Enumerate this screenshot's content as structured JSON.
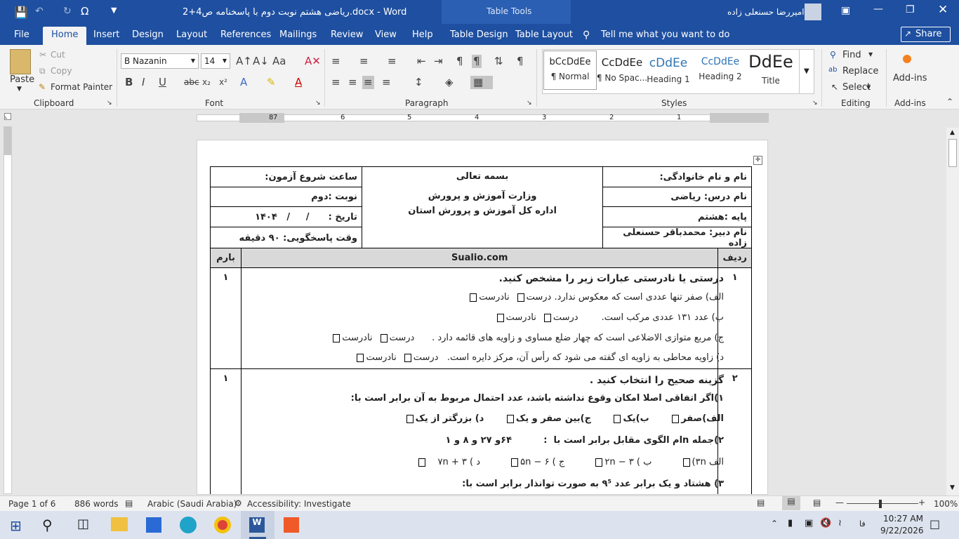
{
  "titlebar": {
    "doc_title": "ریاضی هشتم نوبت دوم با پاسخنامه ص4+2.docx - Word",
    "table_tools": "Table Tools",
    "user": "امیررضا حسنعلی زاده"
  },
  "tabs": [
    "File",
    "Home",
    "Insert",
    "Design",
    "Layout",
    "References",
    "Mailings",
    "Review",
    "View",
    "Help",
    "Table Design",
    "Table Layout"
  ],
  "tell_me": "Tell me what you want to do",
  "share": "Share",
  "clipboard": {
    "paste": "Paste",
    "cut": "Cut",
    "copy": "Copy",
    "format_painter": "Format Painter",
    "label": "Clipboard"
  },
  "font": {
    "name": "B Nazanin",
    "size": "14",
    "label": "Font"
  },
  "paragraph": {
    "label": "Paragraph"
  },
  "styles": {
    "label": "Styles",
    "items": [
      {
        "sample": "bCcDdEe",
        "name": "¶ Normal"
      },
      {
        "sample": "CcDdEe",
        "name": "¶ No Spac..."
      },
      {
        "sample": "cDdEe",
        "name": "Heading 1"
      },
      {
        "sample": "CcDdEe",
        "name": "Heading 2"
      },
      {
        "sample": "DdEe",
        "name": "Title"
      }
    ]
  },
  "editing": {
    "find": "Find",
    "replace": "Replace",
    "select": "Select",
    "label": "Editing"
  },
  "addins": {
    "button": "Add-ins",
    "label": "Add-ins"
  },
  "ruler_digits": [
    "8",
    "7",
    "6",
    "5",
    "4",
    "3",
    "2",
    "1"
  ],
  "exam": {
    "header": {
      "r1": {
        "right": "نام و نام خانوادگی:",
        "center": "بسمه تعالی",
        "left": "ساعت شروع آزمون:"
      },
      "r2": {
        "right": "نام درس: ریاضی",
        "center": "وزارت آموزش و پرورش",
        "left": "نوبت :دوم"
      },
      "r3": {
        "right": "پایه :هشتم",
        "center": "اداره کل آموزش و پرورش استان",
        "left": "تاریخ :      /     /   ۱۴۰۴"
      },
      "r4": {
        "right": "نام دبیر: محمدباقر حسنعلی زاده",
        "left": "وقت پاسخگویی: ۹۰ دقیقه"
      }
    },
    "col_headers": {
      "row": "ردیف",
      "site": "Sualio.com",
      "score": "بارم"
    },
    "q1": {
      "num": "۱",
      "score": "۱",
      "title": "درستی یا نادرستی عبارات زیر را مشخص کنید.",
      "items": [
        "الف) صفر تنها عددی است که معکوس ندارد. درست",
        "ب) عدد ۱۳۱ عددی مرکب است.        درست",
        "ج) مربع متوازی الاضلاعی است که چهار ضلع مساوی و زاویه های قائمه دارد .      درست",
        "د) زاویه محاطی به زاویه ای گفته می شود که رأس آن، مرکز دایره است.   درست"
      ],
      "wrong": "نادرست"
    },
    "q2": {
      "num": "۲",
      "score": "۱",
      "title": "گزینه صحیح را انتخاب کنید .",
      "s1": "۱)اگر اتفاقی اصلا امکان وقوع نداشته باشد، عدد احتمال مربوط به آن برابر است با:",
      "s1_opts": [
        "الف)صفر",
        "ب)یک",
        "ج)بین صفر و یک",
        "د) بزرگتر از یک"
      ],
      "s2": "۲)جمله nام الگوی مقابل برابر است با  :          ۶۴و ۲۷ و ۸ و ۱",
      "s2_opts": [
        "الف ۳n)",
        "ب ) ۲n − ۳",
        "ج ) ۶ − ۵n",
        "د ) ۷n + ۳"
      ],
      "s3": "۳) هشتاد و یک برابر عدد ۹⁵ به صورت توانذار برابر است با:"
    }
  },
  "status": {
    "page": "Page 1 of 6",
    "words": "886 words",
    "language": "Arabic (Saudi Arabia)",
    "accessibility": "Accessibility: Investigate",
    "zoom": "100%"
  },
  "taskbar": {
    "time": "10:27 AM",
    "date": "9/22/2026",
    "lang": "فا"
  }
}
